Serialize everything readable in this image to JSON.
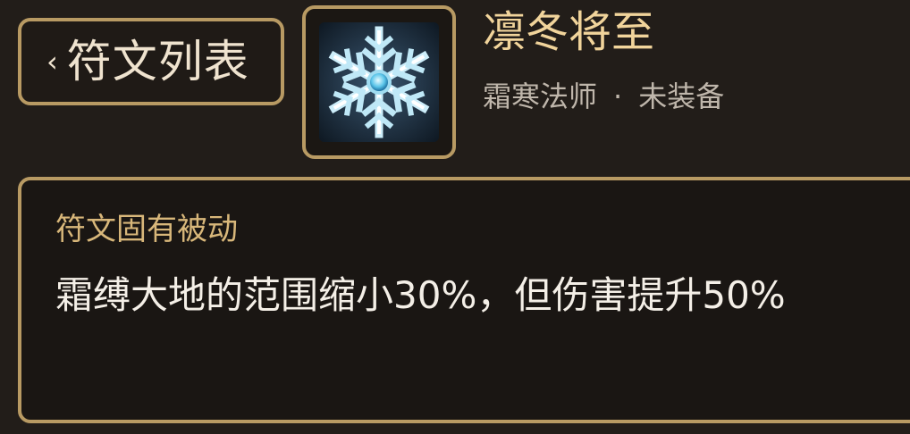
{
  "back_button": {
    "chevron": "‹",
    "label": "符文列表"
  },
  "rune": {
    "icon": "snowflake-icon",
    "name": "凛冬将至",
    "class_name": "霜寒法师",
    "separator": "·",
    "status": "未装备"
  },
  "passive": {
    "title": "符文固有被动",
    "description": "霜缚大地的范围缩小30%，但伤害提升50%"
  },
  "colors": {
    "background": "#221d19",
    "border_gold": "#b89a63",
    "name_gold": "#f1d49b",
    "title_gold": "#d8b77a",
    "meta_gray": "#bfb6ab",
    "text_white": "#f4efe7"
  }
}
